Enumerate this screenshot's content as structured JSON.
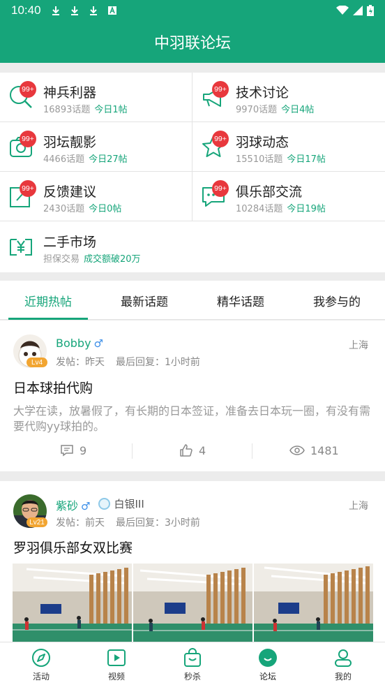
{
  "status_bar": {
    "time": "10:40"
  },
  "app_title": "中羽联论坛",
  "forums": [
    {
      "title": "神兵利器",
      "topics": "16893话题",
      "today": "今日1帖",
      "badge": "99+",
      "icon": "search-icon"
    },
    {
      "title": "技术讨论",
      "topics": "9970话题",
      "today": "今日4帖",
      "badge": "99+",
      "icon": "megaphone-icon"
    },
    {
      "title": "羽坛靓影",
      "topics": "4466话题",
      "today": "今日27帖",
      "badge": "99+",
      "icon": "camera-icon"
    },
    {
      "title": "羽球动态",
      "topics": "15510话题",
      "today": "今日17帖",
      "badge": "99+",
      "icon": "star-icon"
    },
    {
      "title": "反馈建议",
      "topics": "2430话题",
      "today": "今日0帖",
      "badge": "99+",
      "icon": "edit-icon"
    },
    {
      "title": "俱乐部交流",
      "topics": "10284话题",
      "today": "今日19帖",
      "badge": "99+",
      "icon": "chat-icon"
    },
    {
      "title": "二手市场",
      "topics": "担保交易",
      "today": "成交额破20万",
      "icon": "yuan-icon"
    }
  ],
  "tabs": [
    "近期热帖",
    "最新话题",
    "精华话题",
    "我参与的"
  ],
  "posts": [
    {
      "user": "Bobby",
      "gender": "♂",
      "level": "Lv4",
      "posted": "发帖：昨天",
      "last_reply": "最后回复：1小时前",
      "city": "上海",
      "title": "日本球拍代购",
      "body": "大学在读，放暑假了，有长期的日本签证，准备去日本玩一圈，有没有需要代购yy球拍的。",
      "comments": "9",
      "likes": "4",
      "views": "1481"
    },
    {
      "user": "紫砂",
      "gender": "♂",
      "level": "Lv21",
      "rank": "白银III",
      "posted": "发帖：前天",
      "last_reply": "最后回复：3小时前",
      "city": "上海",
      "title": "罗羽俱乐部女双比赛"
    }
  ],
  "bottom_nav": [
    "活动",
    "视频",
    "秒杀",
    "论坛",
    "我的"
  ],
  "colors": {
    "primary": "#16a57a",
    "badge": "#e8383d",
    "level": "#f2a531",
    "gender": "#3b8ee8"
  }
}
